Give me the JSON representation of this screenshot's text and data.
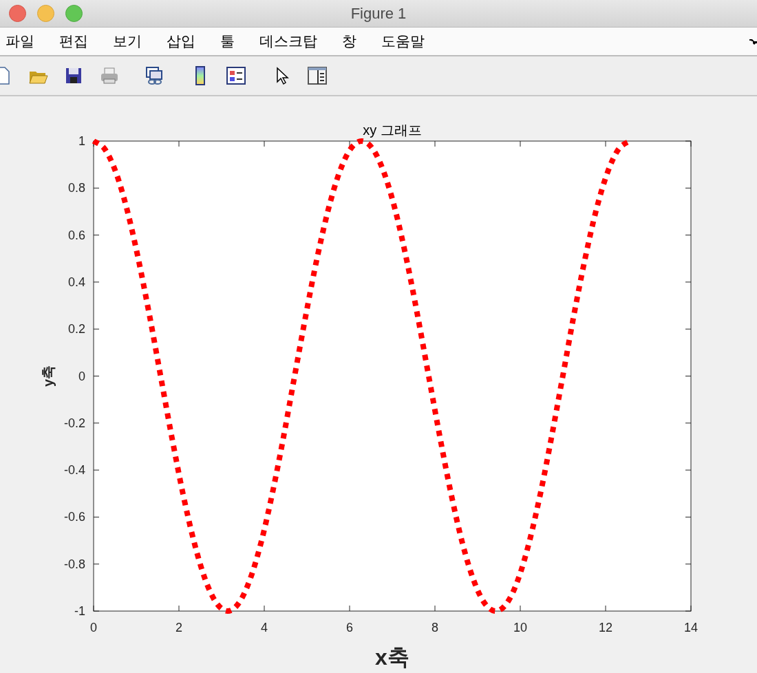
{
  "window": {
    "title": "Figure 1"
  },
  "menu": [
    "파일",
    "편집",
    "보기",
    "삽입",
    "툴",
    "데스크탑",
    "창",
    "도움말"
  ],
  "figure": {
    "chart_data": {
      "type": "line",
      "title": "xy 그래프",
      "xlabel": "x축",
      "ylabel": "y축",
      "xlim": [
        0,
        14
      ],
      "ylim": [
        -1,
        1
      ],
      "xticks": [
        0,
        2,
        4,
        6,
        8,
        10,
        12,
        14
      ],
      "yticks": [
        {
          "value": -1,
          "label": "-1"
        },
        {
          "value": -0.8,
          "label": "-0.8"
        },
        {
          "value": -0.6,
          "label": "-0.6"
        },
        {
          "value": -0.4,
          "label": "-0.4"
        },
        {
          "value": -0.2,
          "label": "-0.2"
        },
        {
          "value": 0,
          "label": "0"
        },
        {
          "value": 0.2,
          "label": "0.2"
        },
        {
          "value": 0.4,
          "label": "0.4"
        },
        {
          "value": 0.6,
          "label": "0.6"
        },
        {
          "value": 0.8,
          "label": "0.8"
        },
        {
          "value": 1,
          "label": "1"
        }
      ],
      "x": [
        0,
        0.262,
        0.524,
        0.785,
        1.047,
        1.309,
        1.571,
        1.833,
        2.094,
        2.356,
        2.618,
        2.88,
        3.142,
        3.403,
        3.665,
        3.927,
        4.189,
        4.451,
        4.712,
        4.974,
        5.236,
        5.498,
        5.76,
        6.021,
        6.283,
        6.545,
        6.807,
        7.069,
        7.33,
        7.592,
        7.854,
        8.116,
        8.378,
        8.639,
        8.901,
        9.163,
        9.425,
        9.687,
        9.948,
        10.21,
        10.472,
        10.734,
        10.996,
        11.257,
        11.519,
        11.781,
        12.043,
        12.305,
        12.566
      ],
      "series": [
        {
          "color": "#ff0000",
          "line_style": "dotted",
          "values": [
            1,
            0.966,
            0.866,
            0.707,
            0.5,
            0.259,
            0,
            -0.259,
            -0.5,
            -0.707,
            -0.866,
            -0.966,
            -1,
            -0.966,
            -0.866,
            -0.707,
            -0.5,
            -0.259,
            0,
            0.259,
            0.5,
            0.707,
            0.866,
            0.966,
            1,
            0.966,
            0.866,
            0.707,
            0.5,
            0.259,
            0,
            -0.259,
            -0.5,
            -0.707,
            -0.866,
            -0.966,
            -1,
            -0.966,
            -0.866,
            -0.707,
            -0.5,
            -0.259,
            0,
            0.259,
            0.5,
            0.707,
            0.866,
            0.966,
            1
          ]
        }
      ]
    }
  }
}
